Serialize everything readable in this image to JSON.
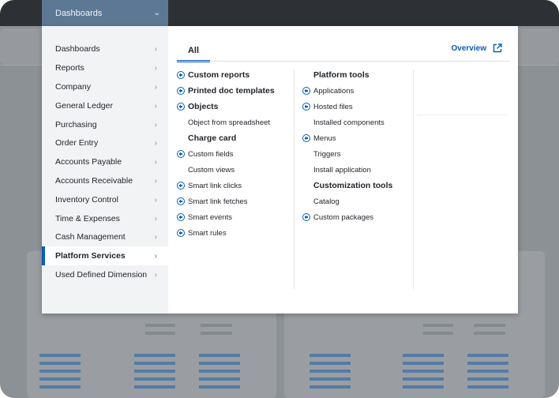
{
  "dropdown": {
    "label": "Dashboards"
  },
  "sidebar": {
    "items": [
      {
        "label": "Dashboards"
      },
      {
        "label": "Reports"
      },
      {
        "label": "Company"
      },
      {
        "label": "General Ledger"
      },
      {
        "label": "Purchasing"
      },
      {
        "label": "Order Entry"
      },
      {
        "label": "Accounts Payable"
      },
      {
        "label": "Accounts Receivable"
      },
      {
        "label": "Inventory Control"
      },
      {
        "label": "Time & Expenses"
      },
      {
        "label": "Cash Management"
      },
      {
        "label": "Platform Services"
      },
      {
        "label": "Used Defined Dimension"
      }
    ],
    "active_index": 11
  },
  "tabs": {
    "all_label": "All"
  },
  "overview": {
    "label": "Overview",
    "icon": "external-link-icon"
  },
  "columns": {
    "col1": [
      {
        "label": "Custom reports",
        "type": "head",
        "plus": true
      },
      {
        "label": "Printed doc templates",
        "type": "head",
        "plus": true
      },
      {
        "label": "Objects",
        "type": "head",
        "plus": true
      },
      {
        "label": "Object from spreadsheet",
        "type": "item",
        "plus": false
      },
      {
        "label": "Charge card",
        "type": "head",
        "plus": false
      },
      {
        "label": "Custom fields",
        "type": "item",
        "plus": true
      },
      {
        "label": "Custom views",
        "type": "item",
        "plus": false
      },
      {
        "label": "Smart link clicks",
        "type": "item",
        "plus": true
      },
      {
        "label": "Smart link fetches",
        "type": "item",
        "plus": true
      },
      {
        "label": "Smart events",
        "type": "item",
        "plus": true
      },
      {
        "label": "Smart rules",
        "type": "item",
        "plus": true
      }
    ],
    "col2": [
      {
        "label": "Platform tools",
        "type": "head",
        "plus": false
      },
      {
        "label": "Applications",
        "type": "item",
        "plus": true
      },
      {
        "label": "Hosted files",
        "type": "item",
        "plus": true
      },
      {
        "label": "Installed components",
        "type": "item",
        "plus": false
      },
      {
        "label": "Menus",
        "type": "item",
        "plus": true
      },
      {
        "label": "Triggers",
        "type": "item",
        "plus": false
      },
      {
        "label": "Install application",
        "type": "item",
        "plus": false
      },
      {
        "label": "Customization tools",
        "type": "head",
        "plus": false
      },
      {
        "label": "Catalog",
        "type": "item",
        "plus": false
      },
      {
        "label": "Custom packages",
        "type": "item",
        "plus": true
      }
    ]
  },
  "colors": {
    "accent": "#0a5db8",
    "dropdown_bg": "#5d7895",
    "topbar_bg": "#2d3035",
    "sidebar_bg": "#f1f3f5"
  }
}
